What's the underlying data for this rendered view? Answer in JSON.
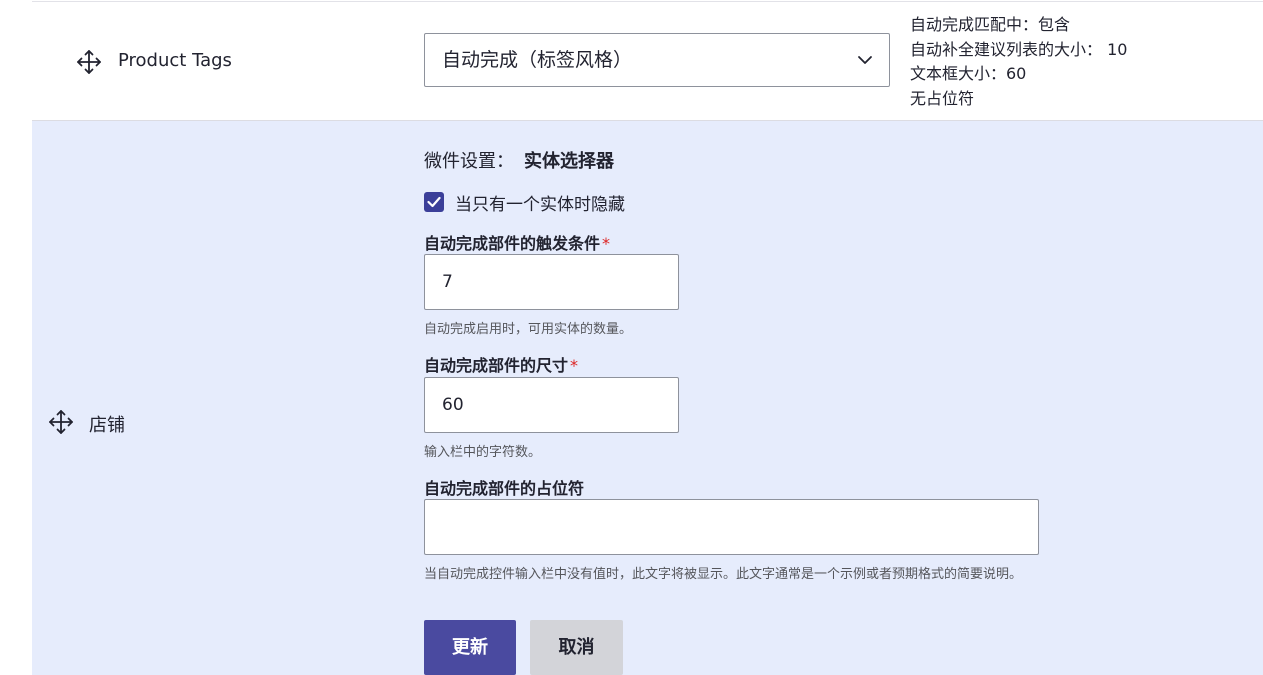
{
  "row1": {
    "field_label": "Product Tags",
    "widget_select": "自动完成（标签风格）",
    "summary": [
      "自动完成匹配中：包含",
      "自动补全建议列表的大小： 10",
      "文本框大小：60",
      "无占位符"
    ]
  },
  "row2": {
    "field_label": "店铺",
    "widget_settings_label": "微件设置：",
    "widget_name": "实体选择器",
    "hide_single_entity": {
      "label": "当只有一个实体时隐藏",
      "checked": true
    },
    "threshold": {
      "label": "自动完成部件的触发条件",
      "required_mark": "*",
      "value": "7",
      "help": "自动完成启用时，可用实体的数量。"
    },
    "size": {
      "label": "自动完成部件的尺寸",
      "required_mark": "*",
      "value": "60",
      "help": "输入栏中的字符数。"
    },
    "placeholder": {
      "label": "自动完成部件的占位符",
      "value": "",
      "help": "当自动完成控件输入栏中没有值时，此文字将被显示。此文字通常是一个示例或者预期格式的简要说明。"
    },
    "buttons": {
      "update": "更新",
      "cancel": "取消"
    }
  },
  "colors": {
    "settings_bg": "#e6ecfc",
    "primary_button": "#4a4aa0",
    "secondary_button": "#d3d4d9",
    "checkbox": "#3b3f99",
    "required": "#dc2323"
  },
  "icons": {
    "drag_handle": "move-arrows-icon",
    "dropdown": "chevron-down-icon",
    "check": "checkmark-icon"
  }
}
